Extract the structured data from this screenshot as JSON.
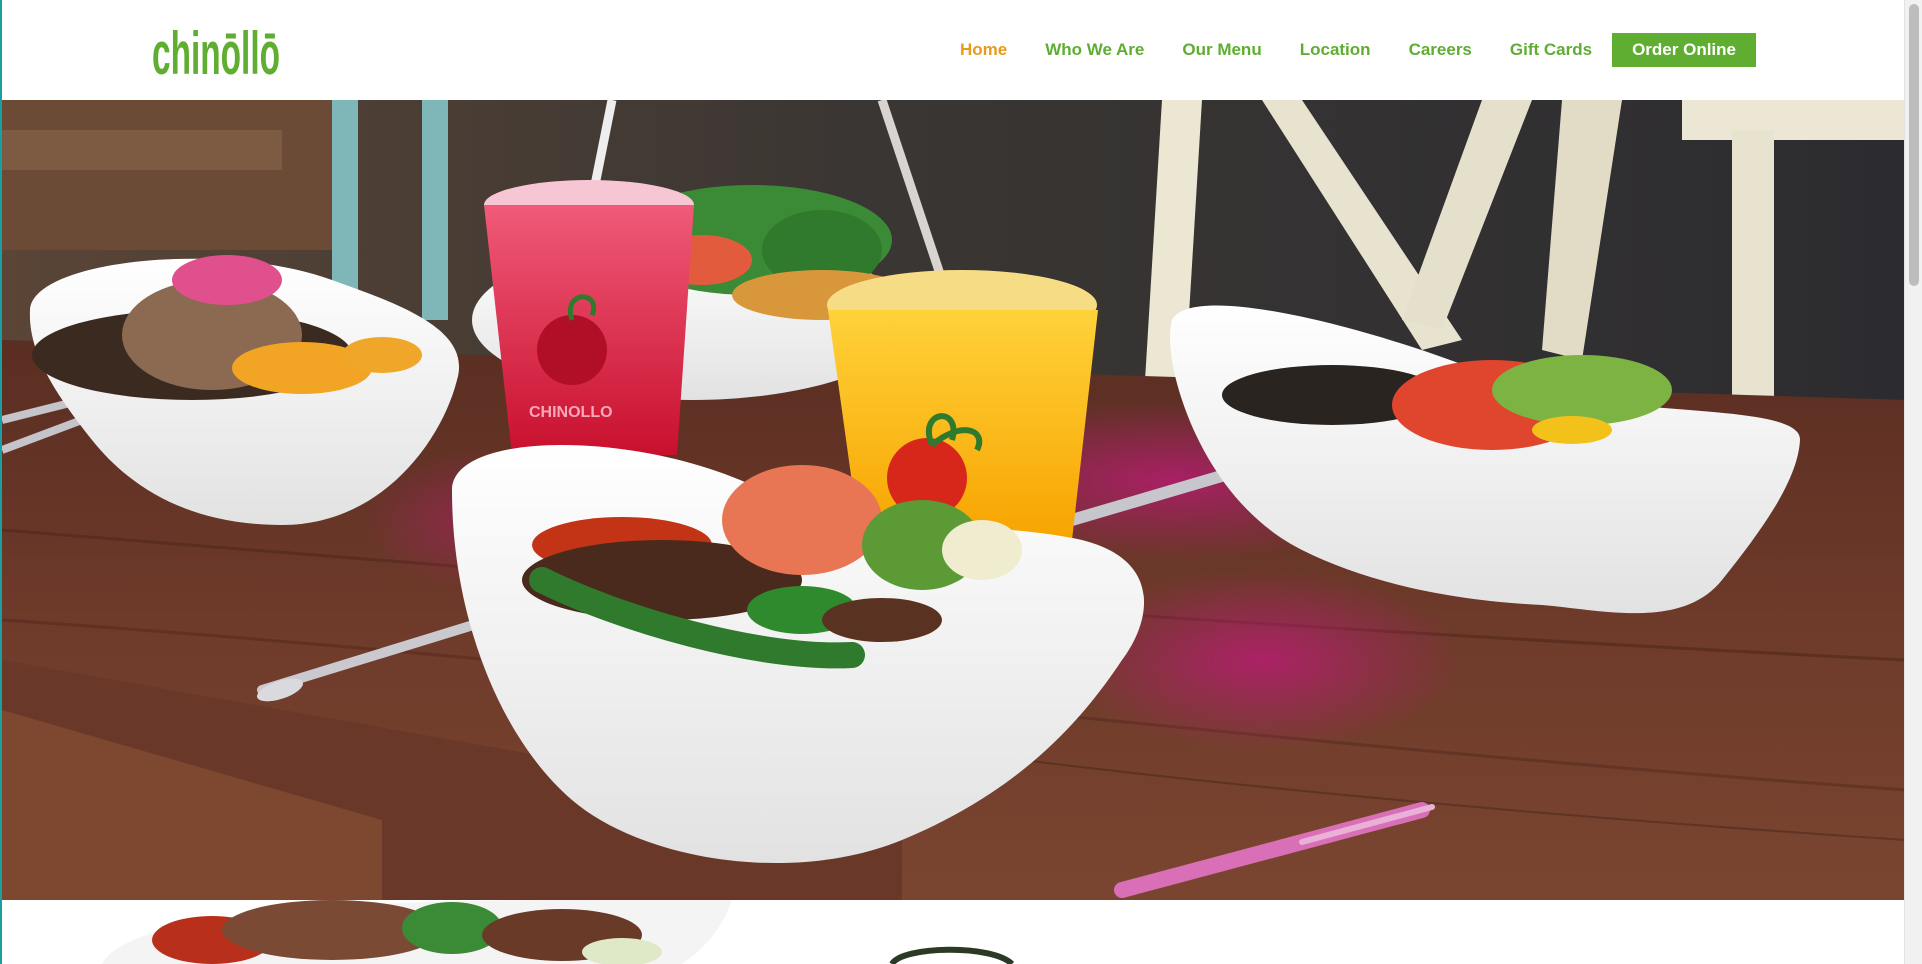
{
  "brand": {
    "logo_text": "chinōllō",
    "logo_color": "#5fae32"
  },
  "nav": {
    "items": [
      {
        "label": "Home",
        "active": true
      },
      {
        "label": "Who We Are",
        "active": false
      },
      {
        "label": "Our Menu",
        "active": false
      },
      {
        "label": "Location",
        "active": false
      },
      {
        "label": "Careers",
        "active": false
      },
      {
        "label": "Gift Cards",
        "active": false
      }
    ],
    "cta_label": "Order Online",
    "link_color": "#5fae32",
    "active_color": "#e89a1c"
  },
  "hero": {
    "image": "photo-food-bowls-drinks-on-wooden-table",
    "cup_print": "CHINOLLO"
  },
  "scrollbar": {
    "position_fraction": 0.0
  }
}
